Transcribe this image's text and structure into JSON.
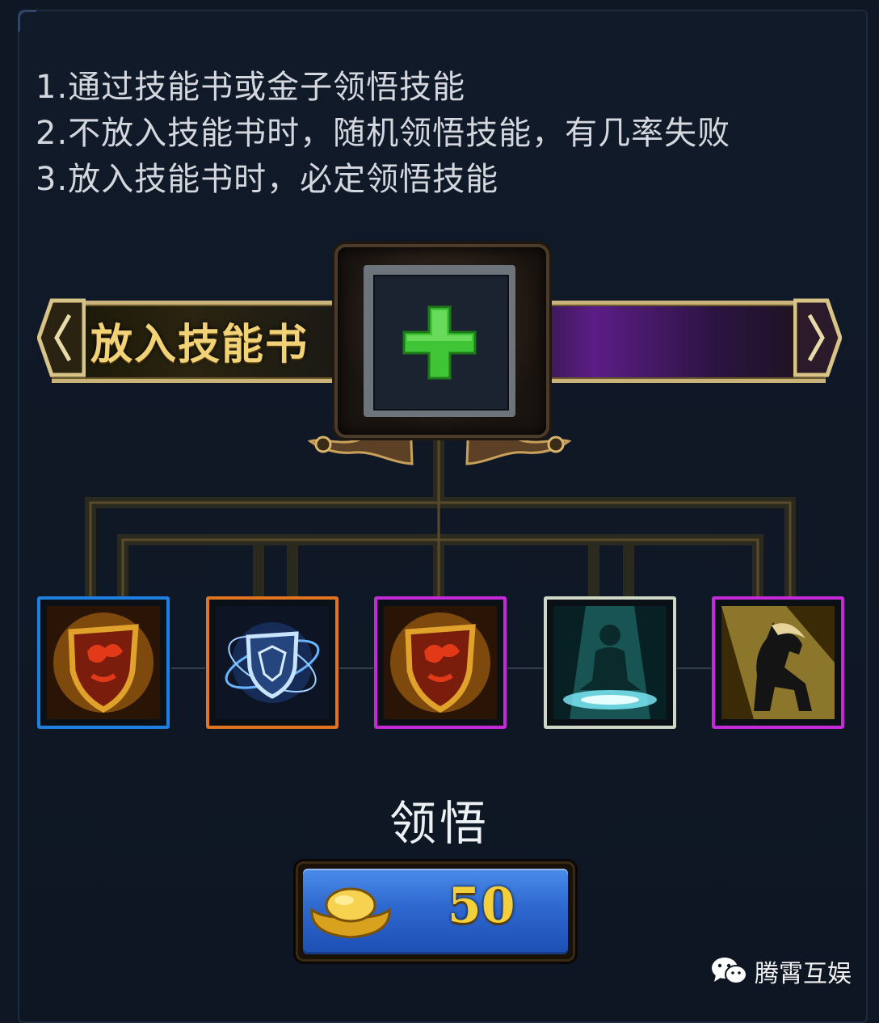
{
  "rules": [
    "1.通过技能书或金子领悟技能",
    "2.不放入技能书时，随机领悟技能，有几率失败",
    "3.放入技能书时，必定领悟技能"
  ],
  "banner": {
    "label": "放入技能书"
  },
  "slot": {
    "icon": "green-plus-icon"
  },
  "skills": [
    {
      "icon": "red-shield-icon",
      "rarity_color": "#1f7fe0"
    },
    {
      "icon": "blue-orbit-shield-icon",
      "rarity_color": "#e07420"
    },
    {
      "icon": "red-shield-icon",
      "rarity_color": "#c42ad8"
    },
    {
      "icon": "meditating-figure-icon",
      "rarity_color": "#cfd8c4"
    },
    {
      "icon": "black-horse-icon",
      "rarity_color": "#c42ad8"
    }
  ],
  "learn": {
    "label": "领悟",
    "cost": "50",
    "currency_icon": "gold-ingot-icon"
  },
  "watermark": {
    "text": "腾霄互娱",
    "icon": "wechat-icon"
  }
}
